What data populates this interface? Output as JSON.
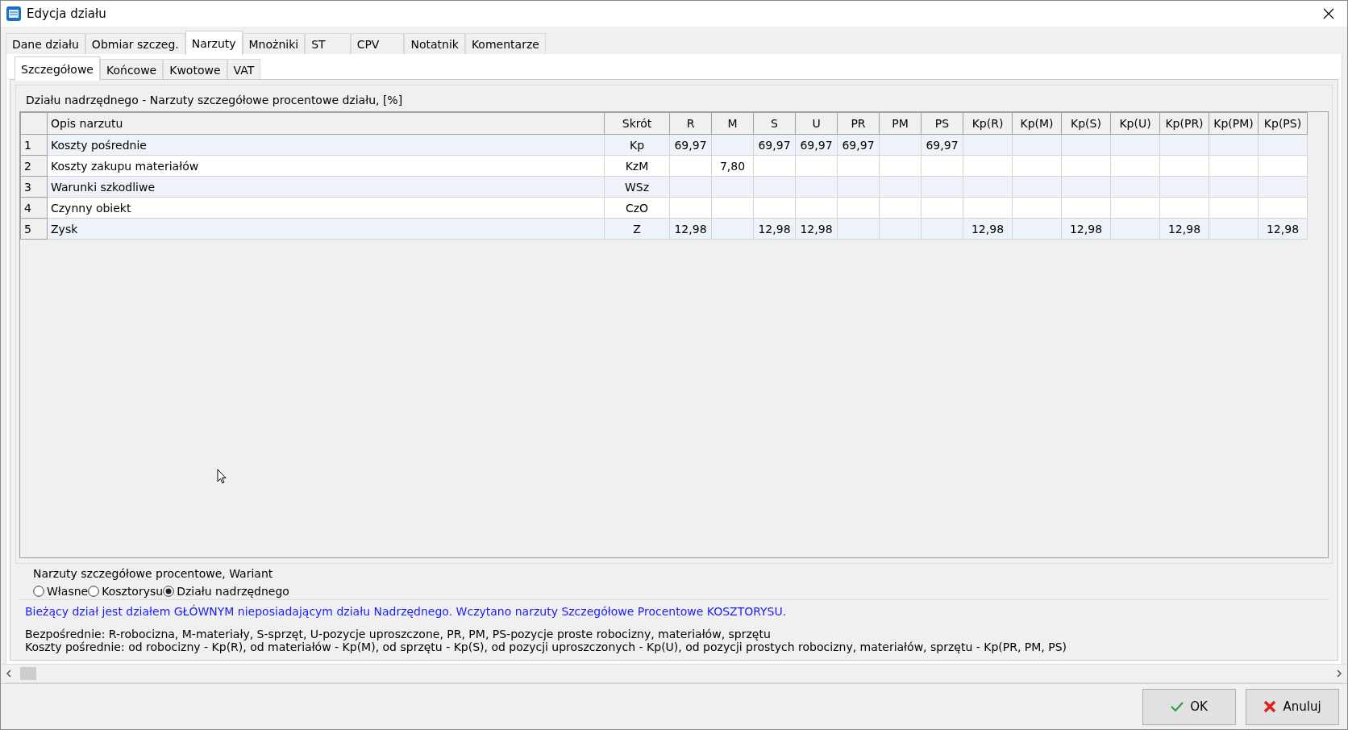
{
  "window": {
    "title": "Edycja działu"
  },
  "tabs": [
    {
      "label": "Dane działu",
      "selected": false
    },
    {
      "label": "Obmiar szczeg.",
      "selected": false
    },
    {
      "label": "Narzuty",
      "selected": true
    },
    {
      "label": "Mnożniki",
      "selected": false
    },
    {
      "label": "ST",
      "selected": false
    },
    {
      "label": "CPV",
      "selected": false
    },
    {
      "label": "Notatnik",
      "selected": false
    },
    {
      "label": "Komentarze",
      "selected": false
    }
  ],
  "subtabs": [
    {
      "label": "Szczegółowe",
      "selected": true
    },
    {
      "label": "Końcowe",
      "selected": false
    },
    {
      "label": "Kwotowe",
      "selected": false
    },
    {
      "label": "VAT",
      "selected": false
    }
  ],
  "group_title": "Działu nadrzędnego - Narzuty szczegółowe procentowe działu, [%]",
  "table": {
    "columns": [
      "Opis narzutu",
      "Skrót",
      "R",
      "M",
      "S",
      "U",
      "PR",
      "PM",
      "PS",
      "Kp(R)",
      "Kp(M)",
      "Kp(S)",
      "Kp(U)",
      "Kp(PR)",
      "Kp(PM)",
      "Kp(PS)"
    ],
    "rows": [
      {
        "number": "1",
        "cells": [
          "Koszty pośrednie",
          "Kp",
          "69,97",
          "",
          "69,97",
          "69,97",
          "69,97",
          "",
          "69,97",
          "",
          "",
          "",
          "",
          "",
          "",
          ""
        ]
      },
      {
        "number": "2",
        "cells": [
          "Koszty zakupu materiałów",
          "KzM",
          "",
          "7,80",
          "",
          "",
          "",
          "",
          "",
          "",
          "",
          "",
          "",
          "",
          "",
          ""
        ]
      },
      {
        "number": "3",
        "cells": [
          "Warunki szkodliwe",
          "WSz",
          "",
          "",
          "",
          "",
          "",
          "",
          "",
          "",
          "",
          "",
          "",
          "",
          "",
          ""
        ]
      },
      {
        "number": "4",
        "cells": [
          "Czynny obiekt",
          "CzO",
          "",
          "",
          "",
          "",
          "",
          "",
          "",
          "",
          "",
          "",
          "",
          "",
          "",
          ""
        ]
      },
      {
        "number": "5",
        "cells": [
          "Zysk",
          "Z",
          "12,98",
          "",
          "12,98",
          "12,98",
          "",
          "",
          "",
          "12,98",
          "",
          "12,98",
          "",
          "12,98",
          "",
          "12,98"
        ]
      }
    ]
  },
  "variant": {
    "title": "Narzuty szczegółowe procentowe, Wariant",
    "options": [
      {
        "label": "Własne",
        "selected": false
      },
      {
        "label": "Kosztorysu",
        "selected": false
      },
      {
        "label": "Działu nadrzędnego",
        "selected": true
      }
    ]
  },
  "notice": "Bieżący dział jest działem GŁÓWNYM nieposiadającym działu Nadrzędnego. Wczytano narzuty Szczegółowe Procentowe KOSZTORYSU.",
  "legend": [
    "Bezpośrednie: R-robocizna, M-materiały, S-sprzęt, U-pozycje uproszczone, PR, PM, PS-pozycje proste robocizny, materiałów, sprzętu",
    "Koszty pośrednie: od robocizny - Kp(R), od materiałów - Kp(M), od sprzętu - Kp(S), od pozycji uproszczonych - Kp(U), od pozycji prostych robocizny, materiałów, sprzętu - Kp(PR, PM, PS)"
  ],
  "buttons": [
    {
      "kind": "ok",
      "label": "OK"
    },
    {
      "kind": "cancel",
      "label": "Anuluj"
    }
  ]
}
